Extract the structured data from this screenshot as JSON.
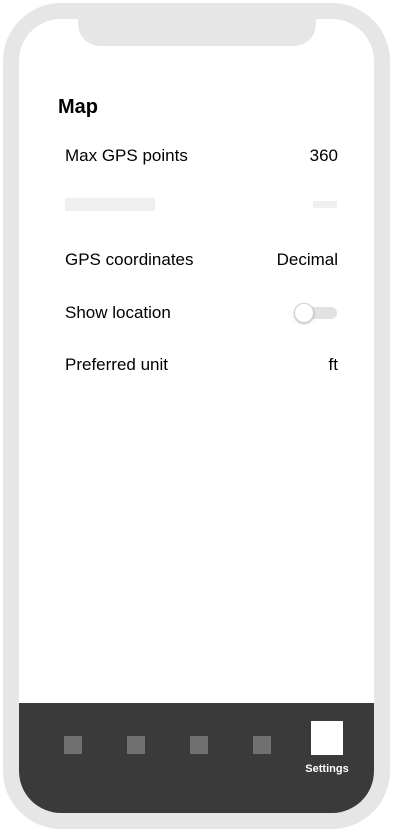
{
  "section": {
    "title": "Map"
  },
  "settings": {
    "max_gps_points": {
      "label": "Max GPS points",
      "value": "360"
    },
    "gps_coordinates": {
      "label": "GPS coordinates",
      "value": "Decimal"
    },
    "show_location": {
      "label": "Show location",
      "enabled": false
    },
    "preferred_unit": {
      "label": "Preferred unit",
      "value": "ft"
    }
  },
  "tabbar": {
    "active_tab": "Settings",
    "tabs": [
      {
        "icon": "square-icon"
      },
      {
        "icon": "square-icon"
      },
      {
        "icon": "square-icon"
      },
      {
        "icon": "square-icon"
      },
      {
        "icon": "square-icon",
        "label": "Settings"
      }
    ]
  },
  "colors": {
    "tabbar_background": "#3a3a3a",
    "inactive_tab_icon": "#707070",
    "active_tab_icon": "#ffffff",
    "device_frame": "#e6e6e6"
  }
}
